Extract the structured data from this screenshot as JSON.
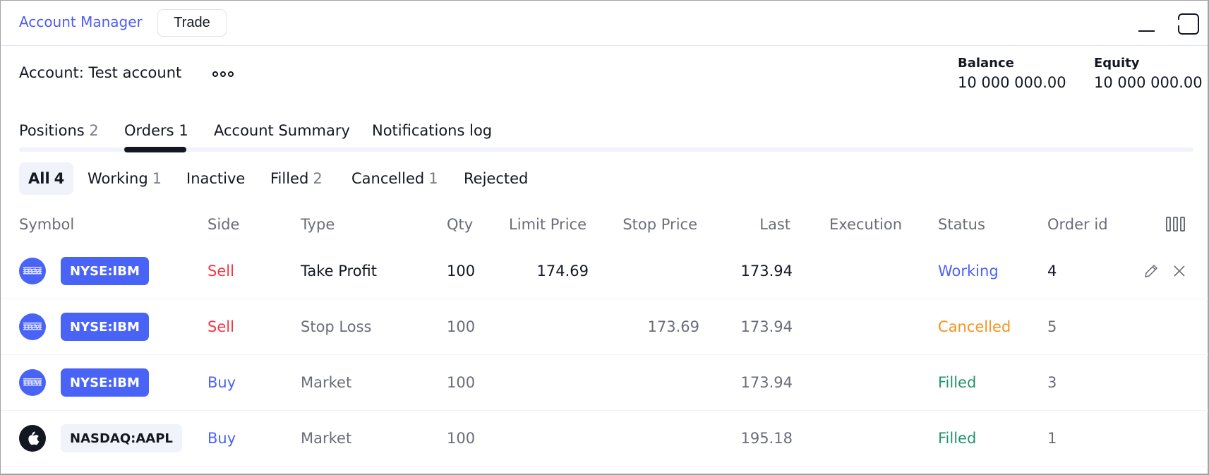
{
  "header": {
    "title": "Account Manager",
    "trade_button": "Trade",
    "minimize_icon": "minimize-icon",
    "maximize_icon": "maximize-icon"
  },
  "account": {
    "label": "Account: Test account",
    "more_icon": "more-icon",
    "balance_label": "Balance",
    "balance_value": "10 000 000.00",
    "equity_label": "Equity",
    "equity_value": "10 000 000.00"
  },
  "tabs": [
    {
      "label": "Positions",
      "count": "2",
      "active": false
    },
    {
      "label": "Orders",
      "count": "1",
      "active": true
    },
    {
      "label": "Account Summary",
      "count": "",
      "active": false
    },
    {
      "label": "Notifications log",
      "count": "",
      "active": false
    }
  ],
  "filters": [
    {
      "label": "All",
      "count": "4",
      "active": true
    },
    {
      "label": "Working",
      "count": "1",
      "active": false
    },
    {
      "label": "Inactive",
      "count": "",
      "active": false
    },
    {
      "label": "Filled",
      "count": "2",
      "active": false
    },
    {
      "label": "Cancelled",
      "count": "1",
      "active": false
    },
    {
      "label": "Rejected",
      "count": "",
      "active": false
    }
  ],
  "table": {
    "columns": [
      "Symbol",
      "Side",
      "Type",
      "Qty",
      "Limit Price",
      "Stop Price",
      "Last",
      "Execution",
      "Status",
      "Order id"
    ],
    "columns_icon": "columns-icon",
    "rows": [
      {
        "logo": "IBM",
        "symbol": "NYSE:IBM",
        "side": "Sell",
        "type": "Take Profit",
        "qty": "100",
        "limit_price": "174.69",
        "stop_price": "",
        "last": "173.94",
        "execution": "",
        "status": "Working",
        "order_id": "4",
        "actions": [
          "edit-icon",
          "close-icon"
        ]
      },
      {
        "logo": "IBM",
        "symbol": "NYSE:IBM",
        "side": "Sell",
        "type": "Stop Loss",
        "qty": "100",
        "limit_price": "",
        "stop_price": "173.69",
        "last": "173.94",
        "execution": "",
        "status": "Cancelled",
        "order_id": "5"
      },
      {
        "logo": "IBM",
        "symbol": "NYSE:IBM",
        "side": "Buy",
        "type": "Market",
        "qty": "100",
        "limit_price": "",
        "stop_price": "",
        "last": "173.94",
        "execution": "",
        "status": "Filled",
        "order_id": "3"
      },
      {
        "logo": "apple",
        "symbol": "NASDAQ:AAPL",
        "side": "Buy",
        "type": "Market",
        "qty": "100",
        "limit_price": "",
        "stop_price": "",
        "last": "195.18",
        "execution": "",
        "status": "Filled",
        "order_id": "1"
      }
    ]
  },
  "colors": {
    "accent": "#4a63f7",
    "sell": "#f23645",
    "buy": "#4a63f7",
    "working": "#4a63f7",
    "cancelled": "#f7931a",
    "filled": "#22936f"
  }
}
